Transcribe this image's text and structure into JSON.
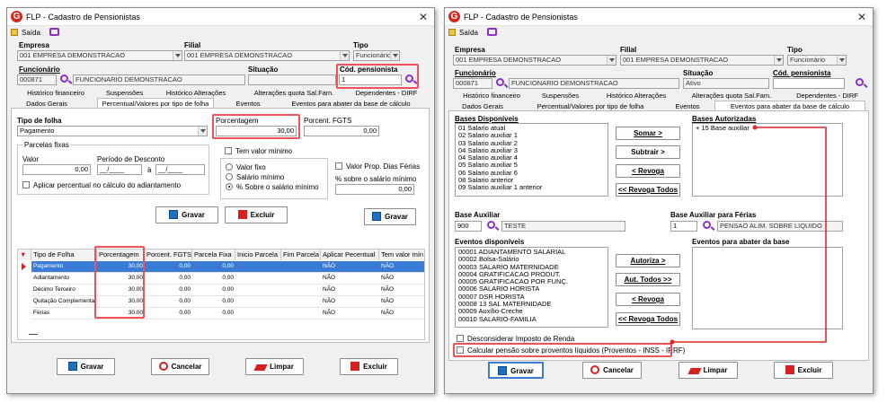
{
  "win_title": "FLP - Cadastro de Pensionistas",
  "saida": "Saída",
  "labels": {
    "empresa": "Empresa",
    "filial": "Filial",
    "tipo": "Tipo",
    "funcionario": "Funcionário",
    "situacao": "Situação",
    "cod_pensionista": "Cód. pensionista"
  },
  "left": {
    "empresa": "001 EMPRESA DEMONSTRACAO",
    "filial": "001 EMPRESA DEMONSTRACAO",
    "tipo": "Funcionário",
    "func_code": "000871",
    "func_name": "FUNCIONARIO DEMONSTRACAO",
    "situacao": "",
    "cod_pensionista": "1",
    "tabs_row1": [
      "Histórico financeiro",
      "Suspensões",
      "Histórico Alterações",
      "Alterações quota Sal.Fam.",
      "Dependentes - DIRF"
    ],
    "tabs_row2": [
      "Dados Gerais",
      "Percentual/Valores por tipo de folha",
      "Eventos",
      "Eventos para abater da base de cálculo"
    ],
    "tipo_folha_label": "Tipo de folha",
    "tipo_folha": "Pagamento",
    "porcentagem_label": "Porcentagem",
    "porcentagem": "30,00",
    "porcent_fgts_label": "Porcent. FGTS",
    "porcent_fgts": "0,00",
    "parcelas_fixas": "Parcelas fixas",
    "valor_label": "Valor",
    "valor": "0,00",
    "periodo_label": "Período de Desconto",
    "periodo_de": "__/____",
    "periodo_ate_label": "à",
    "periodo_ate": "__/____",
    "aplicar_perc": "Aplicar percentual no cálculo do adiantamento",
    "tem_valor_minimo": "Tem valor mínimo",
    "valor_fixo": "Valor fixo",
    "salario_minimo": "Salário mínimo",
    "perc_sal_min": "% Sobre o salário mínimo",
    "valor_prop": "Valor Prop. Dias Férias",
    "perc_sal_min2": "% sobre o salário mínimo",
    "perc_sal_min2_val": "0,00",
    "gravar": "Gravar",
    "excluir": "Excluir",
    "gravar2": "Gravar",
    "grid_headers": [
      "Tipo de Folha",
      "Porcentagem",
      "Porcent. FGTS",
      "Parcela Fixa",
      "Inicio Parcela",
      "Fim Parcela",
      "Aplicar Pecentual",
      "Tem valor mín"
    ],
    "grid_rows": [
      [
        "Pagamento",
        "30,00",
        "0,00",
        "0,00",
        "",
        "",
        "NÃO",
        "NÃO"
      ],
      [
        "Adiantamento",
        "30,00",
        "0,00",
        "0,00",
        "",
        "",
        "NÃO",
        "NÃO"
      ],
      [
        "Décimo Terceiro",
        "30,00",
        "0,00",
        "0,00",
        "",
        "",
        "NÃO",
        "NÃO"
      ],
      [
        "Quitação Complementar",
        "30,00",
        "0,00",
        "0,00",
        "",
        "",
        "NÃO",
        "NÃO"
      ],
      [
        "Férias",
        "30,00",
        "0,00",
        "0,00",
        "",
        "",
        "NÃO",
        "NÃO"
      ]
    ],
    "footer": [
      "Gravar",
      "Cancelar",
      "Limpar",
      "Excluir"
    ]
  },
  "right": {
    "empresa": "001 EMPRESA DEMONSTRACAO",
    "filial": "001 EMPRESA DEMONSTRACAO",
    "tipo": "Funcionário",
    "func_code": "000871",
    "func_name": "FUNCIONARIO DEMONSTRACAO",
    "situacao": "Ativo",
    "cod_pensionista": "",
    "tabs_row1": [
      "Histórico financeiro",
      "Suspensões",
      "Histórico Alterações",
      "Alterações quota Sal.Fam.",
      "Dependentes - DIRF"
    ],
    "tabs_row2": [
      "Dados Gerais",
      "Percentual/Valores por tipo de folha",
      "Eventos",
      "Eventos para abater da base de cálculo"
    ],
    "bases_disp_label": "Bases Disponíveis",
    "bases_disp": [
      "01 Salario atual",
      "02 Salario auxiliar 1",
      "03 Salario auxiliar 2",
      "04 Salario auxiliar 3",
      "04 Salario auxiliar 4",
      "05 Salario auxiliar 5",
      "06 Salario auxiliar 6",
      "08 Salario anterior",
      "09 Salario auxiliar 1 anterior"
    ],
    "bases_aut_label": "Bases Autorizadas",
    "bases_aut": [
      "+ 15 Base auxiliar"
    ],
    "somar": "Somar >",
    "subtrair": "Subtrair >",
    "revoga": "< Revoga",
    "revoga_todos": "<< Revoga Todos",
    "base_aux_label": "Base Auxiliar",
    "base_aux_code": "900",
    "base_aux_name": "TESTE",
    "base_aux_ferias_label": "Base Auxiliar para Férias",
    "base_aux_ferias_code": "1",
    "base_aux_ferias_name": "PENSAO ALIM. SOBRE LIQUIDO",
    "eventos_disp_label": "Eventos disponíveis",
    "eventos_disp": [
      "00001 ADIANTAMENTO SALARIAL",
      "00002 Bolsa-Salário",
      "00003 SALARIO MATERNIDADE",
      "00004 GRATIFICACAO PRODUT.",
      "00005 GRATIFICACAO POR FUNÇ.",
      "00006 SALARIO HORISTA",
      "00007 DSR HORISTA",
      "00008 13 SAL MATERNIDADE",
      "00009 Auxílio-Creche",
      "00010 SALARIO-FAMILIA"
    ],
    "eventos_abater_label": "Eventos para abater da base",
    "autoriza": "Autoriza >",
    "aut_todos": "Aut. Todos >>",
    "revoga2": "< Revoga",
    "revoga_todos2": "<< Revoga Todos",
    "desconsiderar": "Desconsiderar Imposto de Renda",
    "calcular": "Calcular pensão sobre proventos líquidos (Proventos - INSS - IRRF)",
    "footer": [
      "Gravar",
      "Cancelar",
      "Limpar",
      "Excluir"
    ]
  },
  "colors": {
    "highlight": "#f0525a",
    "arrow": "#e02828",
    "brand": "#d9261c",
    "selection": "#3a7bd5"
  }
}
